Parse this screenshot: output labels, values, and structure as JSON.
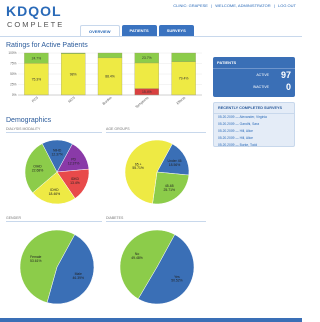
{
  "header": {
    "logo_top": "KDQOL",
    "logo_bottom": "COMPLETE",
    "links": [
      "CLINIC: GRAPESE",
      "|",
      "WELCOME, ADMINISTRATOR",
      "|",
      "LOG OUT"
    ]
  },
  "tabs": [
    {
      "label": "OVERVIEW",
      "active": true
    },
    {
      "label": "PATIENTS",
      "active": false
    },
    {
      "label": "SURVEYS",
      "active": false
    }
  ],
  "ratings": {
    "title": "Ratings for Active Patients",
    "chart_data": {
      "type": "bar",
      "stacked": true,
      "categories": [
        "PCS",
        "MCS",
        "Burden",
        "Symptoms",
        "Effects"
      ],
      "ylim": [
        0,
        100
      ],
      "yticks": [
        "100%",
        "75%",
        "50%",
        "25%",
        "0%"
      ],
      "series": [
        {
          "name": "",
          "color": "#d94040",
          "values": [
            0,
            0,
            0,
            15.4,
            0
          ]
        },
        {
          "name": "",
          "color": "#eeea44",
          "values": [
            75.3,
            98,
            88.4,
            60.9,
            79.4
          ]
        },
        {
          "name": "",
          "color": "#8ccc4a",
          "values": [
            24.7,
            2,
            11.6,
            23.7,
            20.6
          ]
        }
      ],
      "labels": [
        [
          "24.7%",
          "75.3%"
        ],
        [
          "98%"
        ],
        [
          "88.4%"
        ],
        [
          "23.7%",
          "15.4%"
        ],
        [
          "79.4%"
        ]
      ]
    }
  },
  "patients_panel": {
    "title": "PATIENTS",
    "active_label": "ACTIVE",
    "active_value": "97",
    "inactive_label": "INACTIVE",
    "inactive_value": "0"
  },
  "recent_surveys": {
    "title": "RECENTLY COMPLETED SURVEYS",
    "items": [
      "05.20.2009 — Alexander, Virginia",
      "05.20.2009 — Gandhi, Sara",
      "05.20.2009 — Hill, Alice",
      "05.20.2009 — Hill, Alice",
      "05.20.2009 — Burke, Todd"
    ]
  },
  "demographics": {
    "title": "Demographics",
    "charts": [
      {
        "title": "DIALYSIS MODALITY",
        "chart_data": {
          "type": "pie",
          "labels": [
            "PD",
            "IDKD",
            "IDHD",
            "OIHD",
            "NIHD"
          ],
          "percent_labels": [
            "12.37%",
            "13.4%",
            "18.46%",
            "22.68%",
            "12.37%"
          ],
          "values": [
            12.37,
            13.4,
            18.46,
            22.68,
            12.37
          ],
          "colors": [
            "#8a3aa8",
            "#e84a4a",
            "#eeea44",
            "#8ccc4a",
            "#3a6fb6"
          ]
        }
      },
      {
        "title": "AGE GROUPS",
        "chart_data": {
          "type": "pie",
          "labels": [
            "Under 45",
            "45-65",
            "65 +"
          ],
          "percent_labels": [
            "18.56%",
            "25.71%",
            "55.71%"
          ],
          "values": [
            18.56,
            25.71,
            55.71
          ],
          "colors": [
            "#3a6fb6",
            "#8ccc4a",
            "#eeea44"
          ]
        }
      },
      {
        "title": "GENDER",
        "chart_data": {
          "type": "pie",
          "labels": [
            "Male",
            "Female"
          ],
          "percent_labels": [
            "46.39%",
            "53.61%"
          ],
          "values": [
            46.39,
            53.61
          ],
          "colors": [
            "#3a6fb6",
            "#8ccc4a"
          ]
        }
      },
      {
        "title": "DIABETES",
        "chart_data": {
          "type": "pie",
          "labels": [
            "Yes",
            "No"
          ],
          "percent_labels": [
            "50.52%",
            "49.48%"
          ],
          "values": [
            50.52,
            49.48
          ],
          "colors": [
            "#3a6fb6",
            "#8ccc4a"
          ]
        }
      }
    ]
  }
}
